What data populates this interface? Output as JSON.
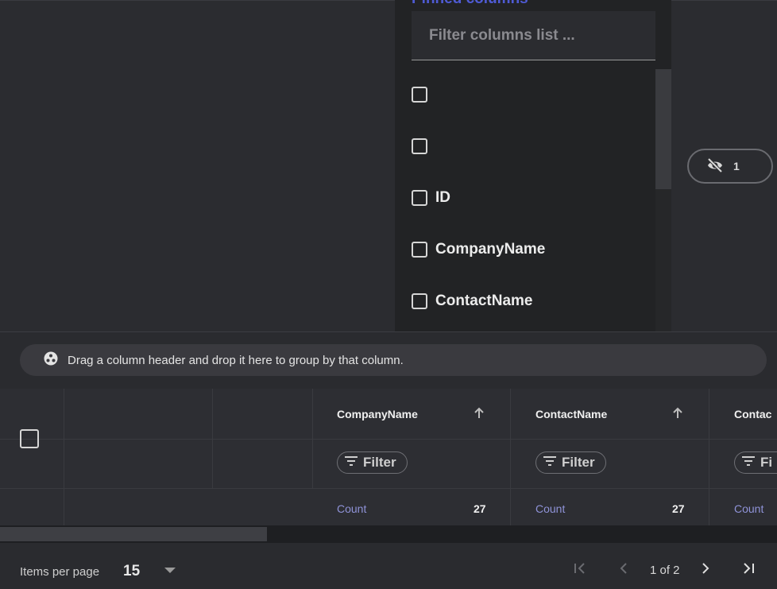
{
  "column_panel": {
    "title": "Pinned columns",
    "filter_placeholder": "Filter columns list ...",
    "items": [
      {
        "label": ""
      },
      {
        "label": ""
      },
      {
        "label": "ID"
      },
      {
        "label": "CompanyName"
      },
      {
        "label": "ContactName"
      }
    ]
  },
  "hidden_columns": {
    "count": "1",
    "icon": "eye-off-icon"
  },
  "group_bar": {
    "text": "Drag a column header and drop it here to group by that column.",
    "icon": "group-icon"
  },
  "grid": {
    "columns": [
      {
        "header": "CompanyName",
        "sort_icon": "arrow-up-icon",
        "filter_label": "Filter",
        "summary_label": "Count",
        "summary_value": "27"
      },
      {
        "header": "ContactName",
        "sort_icon": "arrow-up-icon",
        "filter_label": "Filter",
        "summary_label": "Count",
        "summary_value": "27"
      },
      {
        "header": "Contac",
        "filter_label": "Fi",
        "summary_label": "Count"
      }
    ]
  },
  "paginator": {
    "items_per_page_label": "Items per page",
    "items_per_page_value": "15",
    "page_info": "1 of 2"
  },
  "colors": {
    "accent": "#4f5bd5",
    "summary_label": "#8f93d8",
    "background": "#2a2b2f"
  }
}
